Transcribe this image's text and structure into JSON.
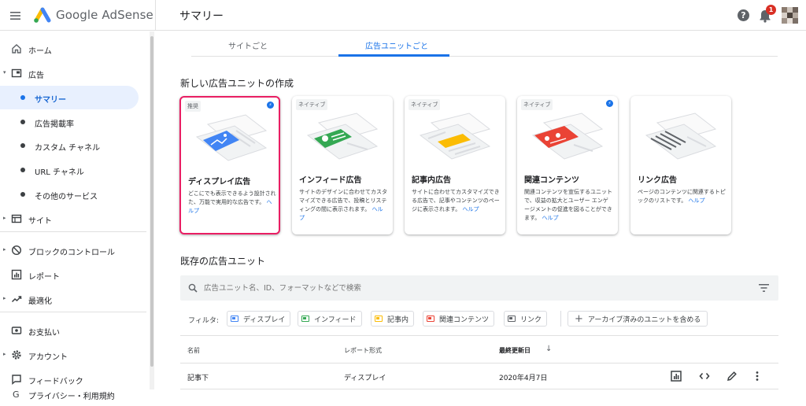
{
  "header": {
    "brand": "Google AdSense",
    "page_title": "サマリー",
    "help_glyph": "?",
    "notification_count": "1"
  },
  "sidebar": {
    "items": [
      {
        "label": "ホーム",
        "icon": "home-icon"
      },
      {
        "label": "広告",
        "icon": "ads-icon"
      },
      {
        "label": "サマリー"
      },
      {
        "label": "広告掲載率"
      },
      {
        "label": "カスタム チャネル"
      },
      {
        "label": "URL チャネル"
      },
      {
        "label": "その他のサービス"
      },
      {
        "label": "サイト",
        "icon": "sites-icon"
      },
      {
        "label": "ブロックのコントロール",
        "icon": "block-icon"
      },
      {
        "label": "レポート",
        "icon": "report-icon"
      },
      {
        "label": "最適化",
        "icon": "optimize-icon"
      },
      {
        "label": "お支払い",
        "icon": "payments-icon"
      },
      {
        "label": "アカウント",
        "icon": "gear-icon"
      },
      {
        "label": "フィードバック",
        "icon": "feedback-icon"
      },
      {
        "label": "プライバシー・利用規約",
        "icon": "google-icon"
      }
    ]
  },
  "tabs": [
    {
      "label": "サイトごと"
    },
    {
      "label": "広告ユニットごと"
    }
  ],
  "create_section": {
    "title": "新しい広告ユニットの作成",
    "cards": [
      {
        "tag": "推奨",
        "bolt": "⚡",
        "title": "ディスプレイ広告",
        "desc": "どこにでも表示できるよう設計された、万能で実用的な広告です。",
        "help": "ヘルプ",
        "accent": "#4285f4"
      },
      {
        "tag": "ネイティブ",
        "title": "インフィード広告",
        "desc": "サイトのデザインに合わせてカスタマイズできる広告で、投稿とリスティングの間に表示されます。",
        "help": "ヘルプ",
        "accent": "#34a853"
      },
      {
        "tag": "ネイティブ",
        "title": "記事内広告",
        "desc": "サイトに合わせてカスタマイズできる広告で、記事やコンテンツのページに表示されます。",
        "help": "ヘルプ",
        "accent": "#fbbc04"
      },
      {
        "tag": "ネイティブ",
        "bolt": "⚡",
        "title": "関連コンテンツ",
        "desc": "関連コンテンツを宣伝するユニットで、収益の拡大とユーザー エンゲージメントの促進を図ることができます。",
        "help": "ヘルプ",
        "accent": "#ea4335"
      },
      {
        "title": "リンク広告",
        "desc": "ページのコンテンツに関連するトピックのリストです。",
        "help": "ヘルプ",
        "accent": "#5f6368"
      }
    ]
  },
  "existing_section": {
    "title": "既存の広告ユニット",
    "search_placeholder": "広告ユニット名、ID、フォーマットなどで検索",
    "filter_label": "フィルタ:",
    "filters": [
      {
        "label": "ディスプレイ",
        "color": "#4285f4"
      },
      {
        "label": "インフィード",
        "color": "#34a853"
      },
      {
        "label": "記事内",
        "color": "#fbbc04"
      },
      {
        "label": "関連コンテンツ",
        "color": "#ea4335"
      },
      {
        "label": "リンク",
        "color": "#5f6368"
      }
    ],
    "archive_label": "アーカイブ済みのユニットを含める",
    "columns": {
      "name": "名前",
      "format": "レポート形式",
      "updated": "最終更新日",
      "sort_glyph": "↓"
    },
    "rows": [
      {
        "name": "記事下",
        "format": "ディスプレイ",
        "updated": "2020年4月7日"
      }
    ]
  }
}
